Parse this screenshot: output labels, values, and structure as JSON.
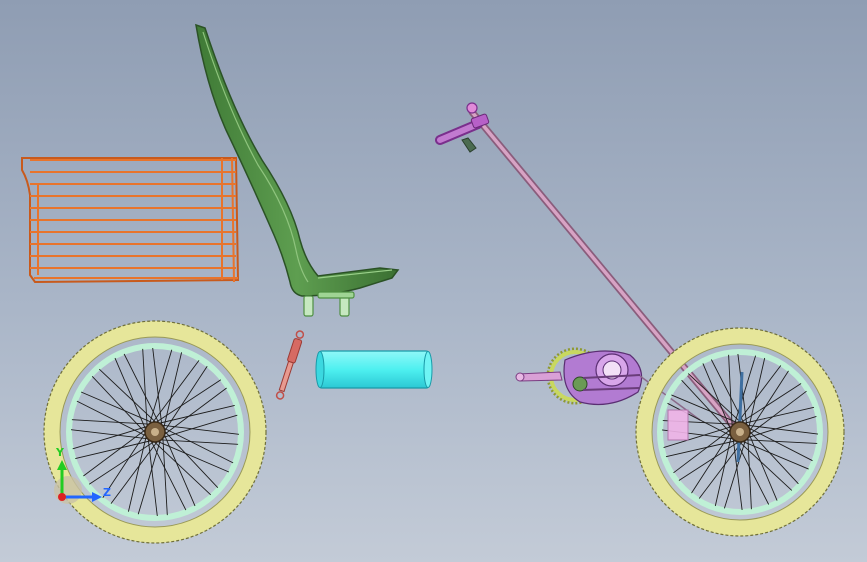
{
  "scene": {
    "background_top": "#8f9db3",
    "background_bottom": "#c3cbd7",
    "parts": {
      "basket": {
        "color": "#e8742c"
      },
      "seat": {
        "color": "#4e8f42"
      },
      "seat_post": {
        "color": "#c6e8c0"
      },
      "shock_absorber": {
        "color": "#d66a63"
      },
      "battery": {
        "color": "#4ef0f0"
      },
      "steering_column": {
        "color": "#c98bb2"
      },
      "handle_grip": {
        "color": "#b760c8"
      },
      "drivetrain": {
        "color": "#c070c8"
      },
      "chainring": {
        "color": "#c8d860"
      },
      "tire": {
        "color": "#e6e69a"
      },
      "rim": {
        "color": "#bff0d6"
      },
      "spokes": {
        "color": "#202020"
      },
      "hub": {
        "color": "#7a6040"
      }
    }
  },
  "triad": {
    "y_label": "Y",
    "z_label": "Z",
    "y_color": "#22cc22",
    "z_color": "#2266ff",
    "origin_color": "#dd2222"
  }
}
